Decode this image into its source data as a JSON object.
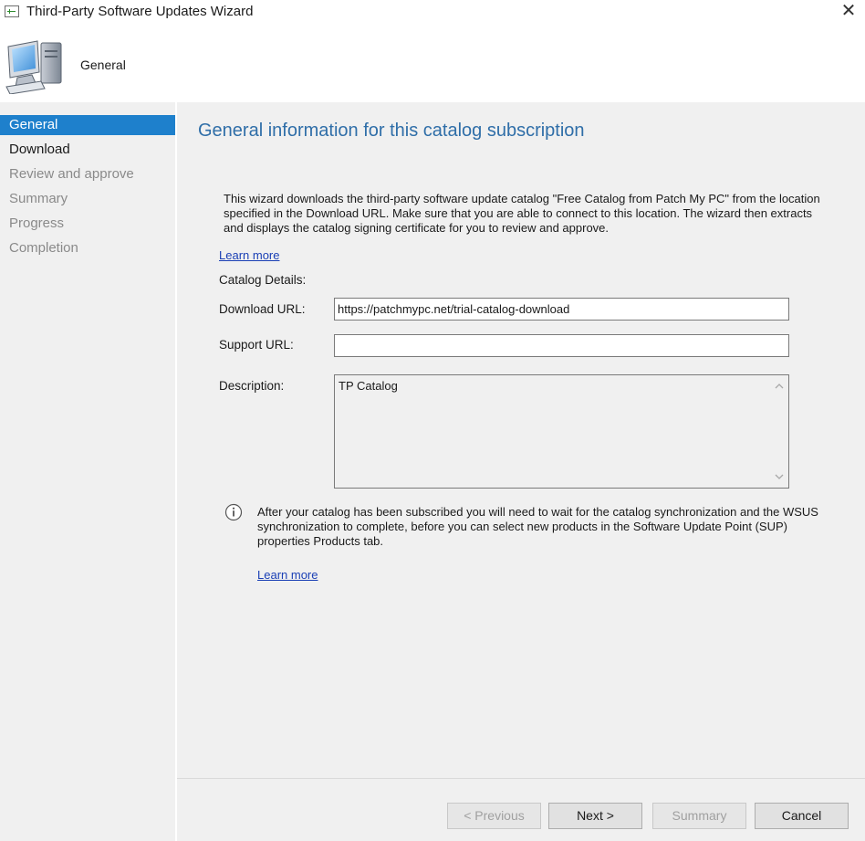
{
  "window": {
    "title": "Third-Party Software Updates Wizard",
    "close_label": "✕"
  },
  "header": {
    "title": "General"
  },
  "sidebar": {
    "items": [
      {
        "label": "General",
        "state": "active"
      },
      {
        "label": "Download",
        "state": "enabled"
      },
      {
        "label": "Review and approve",
        "state": "disabled"
      },
      {
        "label": "Summary",
        "state": "disabled"
      },
      {
        "label": "Progress",
        "state": "disabled"
      },
      {
        "label": "Completion",
        "state": "disabled"
      }
    ]
  },
  "main": {
    "heading": "General information for this catalog subscription",
    "intro": "This wizard downloads the third-party software update catalog \"Free Catalog from Patch My PC\" from the location specified in the Download URL. Make sure that you are able to connect to this location. The wizard then extracts and displays the catalog signing certificate for you to review and approve.",
    "learn_more_1": "Learn more",
    "catalog_details_label": "Catalog Details:",
    "download_url_label": "Download URL:",
    "download_url_value": "https://patchmypc.net/trial-catalog-download",
    "support_url_label": "Support URL:",
    "support_url_value": "",
    "description_label": "Description:",
    "description_value": "TP Catalog",
    "info_text": "After your catalog has been subscribed you will need to wait for the catalog synchronization and the WSUS synchronization to complete, before you can select new products in the Software Update Point (SUP) properties Products tab.",
    "learn_more_2": "Learn more"
  },
  "footer": {
    "previous_label": "< Previous",
    "next_label": "Next >",
    "summary_label": "Summary",
    "cancel_label": "Cancel"
  },
  "colors": {
    "accent": "#1e80cc",
    "heading": "#2f6ea8",
    "link": "#1a3fb5",
    "panel": "#f0f0f0"
  }
}
